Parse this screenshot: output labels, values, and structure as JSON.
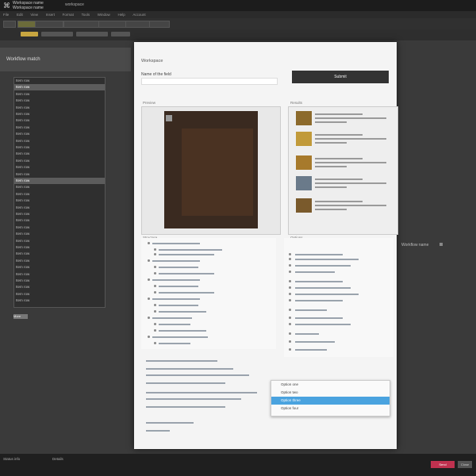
{
  "topbar": {
    "logo": "⌘",
    "title_line1": "Workspace name",
    "title_line2": "Workspace name",
    "link": "workspace"
  },
  "menubar": {
    "items": [
      "File",
      "Edit",
      "View",
      "Insert",
      "Format",
      "Tools",
      "Window",
      "Help",
      "Account"
    ]
  },
  "left": {
    "title": "Workflow match",
    "rows": [
      "Item row",
      "Item row",
      "Item row",
      "Item row",
      "Item row",
      "Item row",
      "Item row",
      "Item row",
      "Item row",
      "Item row",
      "Item row",
      "Item row",
      "Item row",
      "Item row",
      "Item row",
      "Item row",
      "Item row",
      "Item row",
      "Item row",
      "Item row",
      "Item row",
      "Item row",
      "Item row",
      "Item row",
      "Item row",
      "Item row",
      "Item row",
      "Item row",
      "Item row",
      "Item row",
      "Item row",
      "Item row",
      "Item row",
      "Item row"
    ],
    "footer": "More"
  },
  "dialog": {
    "title": "Workspace",
    "name_label": "Name of the field",
    "button": "Submit",
    "preview_label": "Preview",
    "results_label": "Results",
    "tree_label": "Structure",
    "list_label": "Options"
  },
  "dropdown": {
    "items": [
      "Option one",
      "Option two",
      "Option three",
      "Option four"
    ],
    "selected_index": 2
  },
  "side": {
    "label": "Workflow name"
  },
  "status": {
    "left_text": "Status info",
    "mid_text": "Details",
    "red_button": "Send",
    "grey_button": "Close"
  }
}
